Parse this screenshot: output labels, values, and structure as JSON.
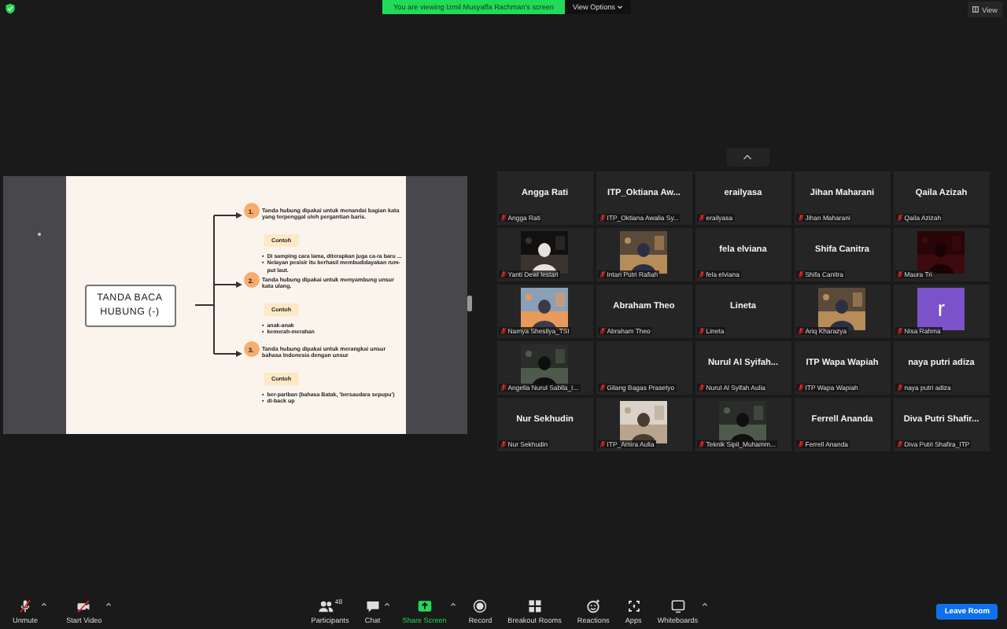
{
  "top_bar": {
    "banner": "You are viewing Izmil Musyaffa Rachman's screen",
    "view_options": "View Options",
    "view": "View"
  },
  "slide": {
    "title": "TANDA BACA HUBUNG (-)",
    "items": [
      {
        "number": "1.",
        "text": "Tanda hubung dipakai untuk menandai bagian kata yang terpenggal oleh pergantian baris.",
        "example_label": "Contoh",
        "bullet": "•",
        "examples": [
          "Di samping cara lama, diterapkan juga ca-ra baru ...",
          "Nelayan pesisir itu berhasil membudidayakan rum-put laut."
        ]
      },
      {
        "number": "2.",
        "text": "Tanda hubung dipakai untuk menyambung unsur kata ulang.",
        "example_label": "Contoh",
        "bullet": "•",
        "examples": [
          "anak-anak",
          "kemerah-merahan"
        ]
      },
      {
        "number": "3.",
        "text": "Tanda hubung dipakai untuk merangkai unsur bahasa Indonesia dengan unsur",
        "example_label": "Contoh",
        "bullet": "•",
        "examples": [
          "ber-pariban (bahasa Batak, 'bersaudara sepupu')",
          "di-back up"
        ]
      }
    ]
  },
  "gallery": [
    {
      "kind": "name",
      "name": "Angga Rati",
      "label": "Angga Rati"
    },
    {
      "kind": "name",
      "name": "ITP_Oktiana  Aw...",
      "label": "ITP_Oktiana Awalia Sy..."
    },
    {
      "kind": "name",
      "name": "erailyasa",
      "label": "erailyasa"
    },
    {
      "kind": "name",
      "name": "Jihan Maharani",
      "label": "Jihan Maharani"
    },
    {
      "kind": "name",
      "name": "Qaila Azizah",
      "label": "Qaila Azizah"
    },
    {
      "kind": "video",
      "label": "Yanti Dewi lestari"
    },
    {
      "kind": "video",
      "label": "Intan Putri Rafiah"
    },
    {
      "kind": "name",
      "name": "fela elviana",
      "label": "fela elviana"
    },
    {
      "kind": "name",
      "name": "Shifa Canitra",
      "label": "Shifa Canitra"
    },
    {
      "kind": "video",
      "label": "Maura Tri"
    },
    {
      "kind": "video",
      "label": "Namya Shesilya_TSI"
    },
    {
      "kind": "name",
      "name": "Abraham Theo",
      "label": "Abraham Theo"
    },
    {
      "kind": "name",
      "name": "Lineta",
      "label": "Lineta"
    },
    {
      "kind": "video",
      "label": "Ariq Kharazya"
    },
    {
      "kind": "avatar",
      "name": "r",
      "label": "Nisa Rahma"
    },
    {
      "kind": "video",
      "label": "Angelia Nurul Sabila_I..."
    },
    {
      "kind": "blank",
      "label": "Gilang Bagas Prasetyo"
    },
    {
      "kind": "name",
      "name": "Nurul  Al  Syifah...",
      "label": "Nurul Al Syifah Aulia"
    },
    {
      "kind": "name",
      "name": "ITP Wapa Wapiah",
      "label": "ITP Wapa Wapiah"
    },
    {
      "kind": "name",
      "name": "naya putri adiza",
      "label": "naya putri adiza"
    },
    {
      "kind": "name",
      "name": "Nur Sekhudin",
      "label": "Nur Sekhudin"
    },
    {
      "kind": "video",
      "label": "ITP_Amira Aulia"
    },
    {
      "kind": "video",
      "label": "Teknik Sipil_Muhamm..."
    },
    {
      "kind": "name",
      "name": "Ferrell Ananda",
      "label": "Ferrell Ananda"
    },
    {
      "kind": "name",
      "name": "Diva  Putri  Shafir...",
      "label": "Diva Putri Shafira_ITP"
    }
  ],
  "toolbar": {
    "left": [
      {
        "kind": "mic",
        "label": "Unmute",
        "caret": true
      },
      {
        "kind": "camera",
        "label": "Start Video",
        "caret": true
      }
    ],
    "center": [
      {
        "kind": "participants",
        "label": "Participants",
        "count": "48",
        "caret": false
      },
      {
        "kind": "chat",
        "label": "Chat",
        "caret": true
      },
      {
        "kind": "share",
        "label": "Share Screen",
        "caret": true
      },
      {
        "kind": "record",
        "label": "Record",
        "caret": false
      },
      {
        "kind": "breakout",
        "label": "Breakout Rooms",
        "caret": false
      },
      {
        "kind": "reactions",
        "label": "Reactions",
        "caret": false
      },
      {
        "kind": "apps",
        "label": "Apps",
        "caret": false
      },
      {
        "kind": "whiteboard",
        "label": "Whiteboards",
        "caret": true
      }
    ],
    "leave": "Leave Room"
  }
}
